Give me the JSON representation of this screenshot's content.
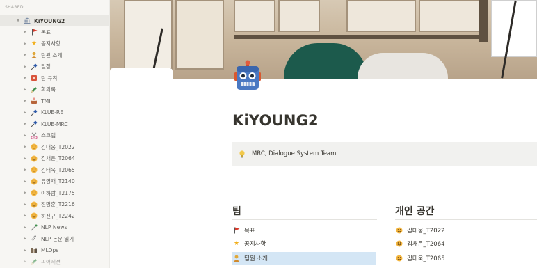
{
  "sidebar": {
    "section": "SHARED",
    "workspace": {
      "label": "KiYOUNG2",
      "icon": "bank-icon"
    },
    "items": [
      {
        "label": "목표",
        "icon": "red-flag-icon"
      },
      {
        "label": "공지사항",
        "icon": "star-icon"
      },
      {
        "label": "팀원 소개",
        "icon": "person-icon"
      },
      {
        "label": "일정",
        "icon": "pushpin-icon"
      },
      {
        "label": "팀 규칙",
        "icon": "rulebook-icon"
      },
      {
        "label": "회의록",
        "icon": "pencil-icon"
      },
      {
        "label": "TMI",
        "icon": "cake-icon"
      },
      {
        "label": "KLUE-RE",
        "icon": "pushpin-icon"
      },
      {
        "label": "KLUE-MRC",
        "icon": "pushpin-icon"
      },
      {
        "label": "스크랩",
        "icon": "scissors-icon"
      },
      {
        "label": "김대웅_T2022",
        "icon": "smile-icon"
      },
      {
        "label": "김채은_T2064",
        "icon": "smile-icon"
      },
      {
        "label": "김태욱_T2065",
        "icon": "smile-icon"
      },
      {
        "label": "유영재_T2140",
        "icon": "smile-icon"
      },
      {
        "label": "이하람_T2175",
        "icon": "smile-icon"
      },
      {
        "label": "진명훈_T2216",
        "icon": "smile-icon"
      },
      {
        "label": "허진규_T2242",
        "icon": "smile-icon"
      },
      {
        "label": "NLP News",
        "icon": "link-icon"
      },
      {
        "label": "NLP 논문 읽기",
        "icon": "paperclip-icon"
      },
      {
        "label": "MLOps",
        "icon": "book-icon"
      },
      {
        "label": "피어세션",
        "icon": "pencil-icon"
      }
    ]
  },
  "page": {
    "title": "KiYOUNG2",
    "icon": "robot-icon",
    "callout": {
      "icon": "lightbulb-icon",
      "text": "MRC, Dialogue System Team"
    }
  },
  "team_column": {
    "heading": "팀",
    "links": [
      {
        "label": "목표",
        "icon": "red-flag-icon"
      },
      {
        "label": "공지사항",
        "icon": "star-icon"
      },
      {
        "label": "팀원 소개",
        "icon": "person-icon"
      }
    ]
  },
  "personal_column": {
    "heading": "개인 공간",
    "links": [
      {
        "label": "김대웅_T2022",
        "icon": "smile-icon"
      },
      {
        "label": "김채은_T2064",
        "icon": "smile-icon"
      },
      {
        "label": "김태욱_T2065",
        "icon": "smile-icon"
      }
    ]
  },
  "colors": {
    "sidebar_bg": "#f7f6f3",
    "text": "#37352f",
    "selected_bg": "#d4e6f5",
    "callout_bg": "#f1f1ef",
    "robot_blue": "#3f6fb5"
  }
}
